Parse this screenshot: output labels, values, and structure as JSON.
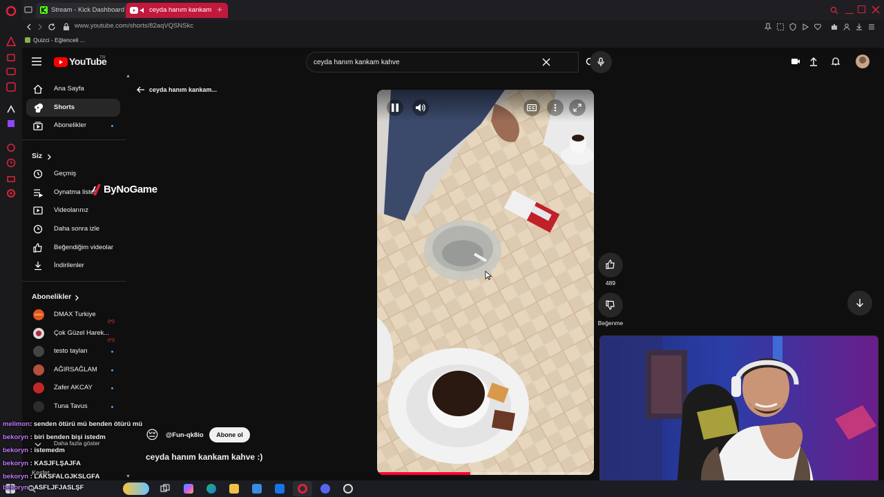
{
  "browser": {
    "tabs": [
      {
        "label": "Stream - Kick Dashboard",
        "icon": "kick-icon"
      },
      {
        "label": "ceyda hanım kankam",
        "icon": "youtube-icon"
      }
    ],
    "url": "www.youtube.com/shorts/82aqVQSNSkc",
    "bookmarks": [
      {
        "label": "Quizci - Eğlenceli ..."
      }
    ]
  },
  "youtube": {
    "logo_text": "YouTube",
    "region": "TR",
    "search_value": "ceyda hanım kankam kahve"
  },
  "sidebar": {
    "main_items": [
      {
        "label": "Ana Sayfa",
        "icon": "home-icon"
      },
      {
        "label": "Shorts",
        "icon": "shorts-icon",
        "active": true
      },
      {
        "label": "Abonelikler",
        "icon": "subscriptions-icon"
      }
    ],
    "you_title": "Siz",
    "you_items": [
      {
        "label": "Geçmiş",
        "icon": "history-icon"
      },
      {
        "label": "Oynatma listel",
        "icon": "playlist-icon"
      },
      {
        "label": "Videolarınız",
        "icon": "your-videos-icon"
      },
      {
        "label": "Daha sonra izle",
        "icon": "watch-later-icon"
      },
      {
        "label": "Beğendiğim videolar",
        "icon": "liked-icon"
      },
      {
        "label": "İndirilenler",
        "icon": "download-icon"
      }
    ],
    "subs_title": "Abonelikler",
    "subs": [
      {
        "label": "DMAX Turkiye",
        "live": true,
        "color": "#e4561b"
      },
      {
        "label": "Çok Güzel Harek...",
        "live": true,
        "color": "#d9d9d9"
      },
      {
        "label": "testo taylan",
        "live": false,
        "color": "#555555"
      },
      {
        "label": "AĞIRSAĞLAM",
        "live": false,
        "color": "#b5503c"
      },
      {
        "label": "Zafer AKCAY",
        "live": false,
        "color": "#c22626"
      },
      {
        "label": "Tuna Tavus",
        "live": false,
        "color": "#3a3a3a"
      }
    ],
    "show_more": "Daha fazla göster",
    "explore": "Keşfet"
  },
  "watermark": "ByNoGame",
  "short": {
    "back_title": "ceyda hanım kankam...",
    "channel": "@Fun-qk8io",
    "subscribe": "Abone ol",
    "title": "ceyda hanım kankam kahve  :)",
    "likes": "489",
    "dislike_label": "Beğenme",
    "progress": 0.43
  },
  "chat": [
    {
      "user": "melimon",
      "sep": ": ",
      "msg": "senden ötürü mü benden ötürü mü"
    },
    {
      "user": "bekoryn",
      "sep": " : ",
      "msg": "biri benden bişi istedm"
    },
    {
      "user": "bekoryn",
      "sep": " : ",
      "msg": "istemedm"
    },
    {
      "user": "bekoryn",
      "sep": " : ",
      "msg": "KASJFLŞAJFA"
    },
    {
      "user": "bekoryn",
      "sep": " : ",
      "msg": "LAKSFALGJKSLGFA"
    },
    {
      "user": "bekoryn",
      "sep": " : ",
      "msg": "ASFLJFJASLŞF"
    }
  ],
  "colors": {
    "brand_red": "#ff0000",
    "tab_active": "#c2183c",
    "link_blue": "#3ea6ff"
  }
}
